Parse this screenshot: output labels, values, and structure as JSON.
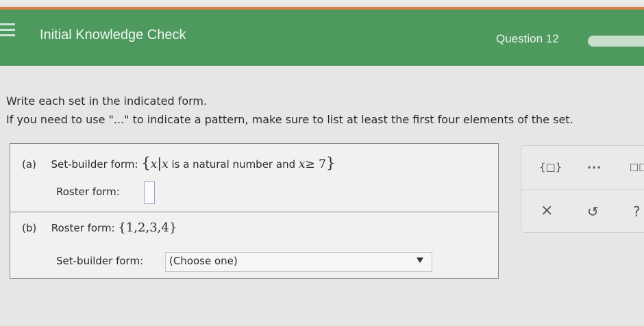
{
  "header": {
    "title": "Initial Knowledge Check",
    "question_label": "Question 12"
  },
  "instructions": {
    "line1": "Write each set in the indicated form.",
    "line2": "If you need to use \"...\" to indicate a pattern, make sure to list at least the first four elements of the set."
  },
  "part_a": {
    "label": "(a)",
    "prompt": "Set-builder form:",
    "set_open": "{",
    "var1": "x",
    "bar": "|",
    "var2": "x",
    "phrase": "is a natural number and",
    "var3": "x",
    "condition": "≥ 7",
    "set_close": "}",
    "answer_prompt": "Roster form:",
    "answer_value": ""
  },
  "part_b": {
    "label": "(b)",
    "prompt": "Roster form:",
    "set": "{1,2,3,4}",
    "answer_prompt": "Set-builder form:",
    "select_value": "(Choose one)"
  },
  "tools": {
    "set_braces_label": "{□}",
    "ellipsis_label": "...",
    "clear_symbol": "×",
    "undo_symbol": "↺",
    "help_symbol": "?"
  },
  "colors": {
    "header_bg": "#4e9a5e",
    "accent_line": "#d9804a"
  }
}
